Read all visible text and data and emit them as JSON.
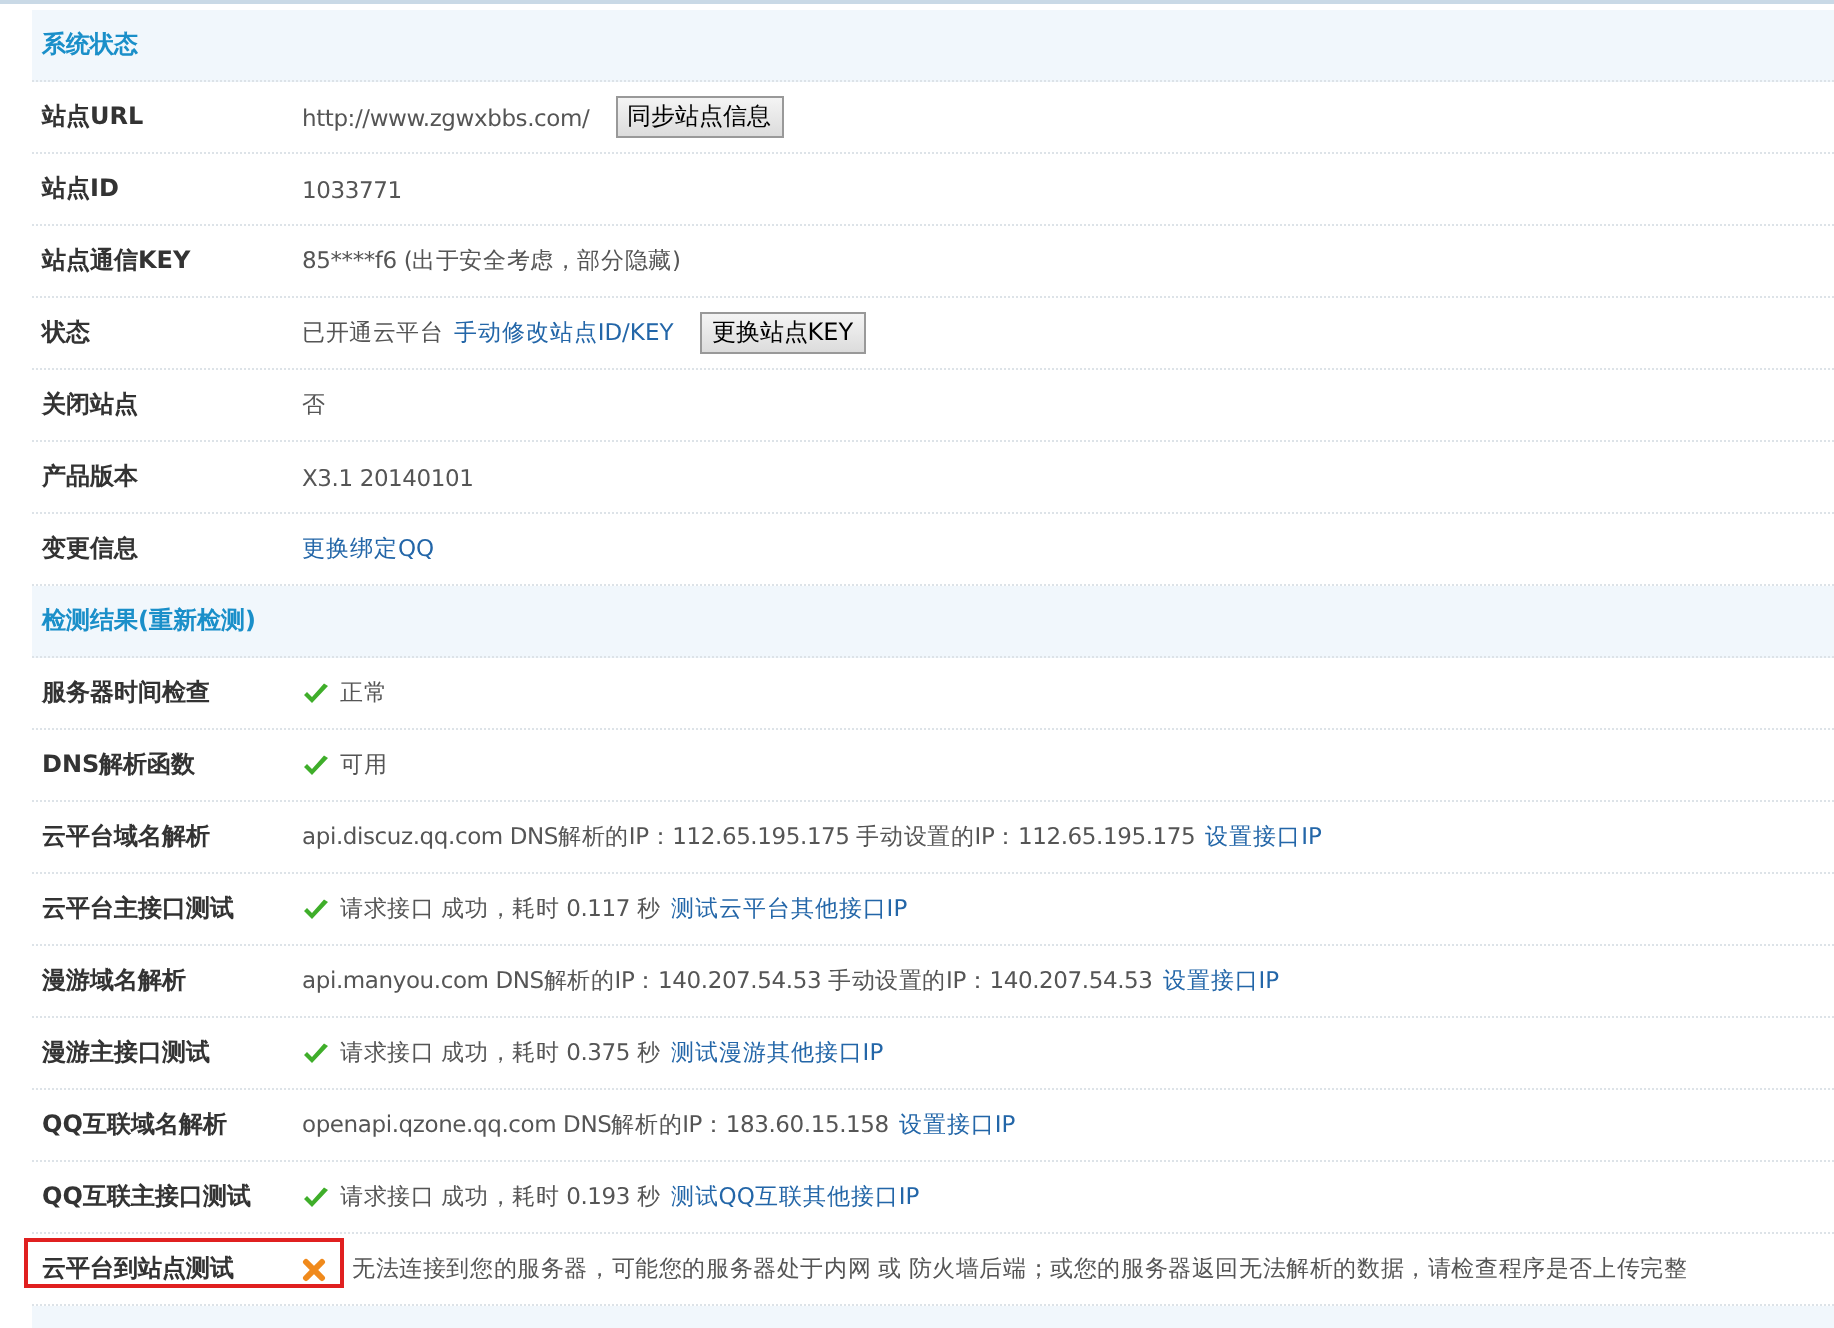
{
  "sections": [
    {
      "title": "系统状态",
      "rows": [
        {
          "label": "站点URL",
          "parts": [
            {
              "kind": "text",
              "text": "http://www.zgwxbbs.com/"
            },
            {
              "kind": "button",
              "text": "同步站点信息"
            }
          ]
        },
        {
          "label": "站点ID",
          "parts": [
            {
              "kind": "text",
              "text": "1033771"
            }
          ]
        },
        {
          "label": "站点通信KEY",
          "parts": [
            {
              "kind": "text",
              "text": "85****f6 (出于安全考虑，部分隐藏)"
            }
          ]
        },
        {
          "label": "状态",
          "parts": [
            {
              "kind": "text",
              "text": "已开通云平台"
            },
            {
              "kind": "link",
              "text": "手动修改站点ID/KEY"
            },
            {
              "kind": "button",
              "text": "更换站点KEY"
            }
          ]
        },
        {
          "label": "关闭站点",
          "parts": [
            {
              "kind": "text",
              "text": "否"
            }
          ]
        },
        {
          "label": "产品版本",
          "parts": [
            {
              "kind": "text",
              "text": "X3.1 20140101"
            }
          ]
        },
        {
          "label": "变更信息",
          "parts": [
            {
              "kind": "link",
              "text": "更换绑定QQ"
            }
          ]
        }
      ]
    },
    {
      "title": "检测结果(重新检测)",
      "rows": [
        {
          "label": "服务器时间检查",
          "passed": true,
          "parts": [
            {
              "kind": "text",
              "text": "正常"
            }
          ]
        },
        {
          "label": "DNS解析函数",
          "passed": true,
          "parts": [
            {
              "kind": "text",
              "text": "可用"
            }
          ]
        },
        {
          "label": "云平台域名解析",
          "parts": [
            {
              "kind": "text",
              "text": "api.discuz.qq.com DNS解析的IP：112.65.195.175 手动设置的IP：112.65.195.175"
            },
            {
              "kind": "link",
              "text": "设置接口IP"
            }
          ]
        },
        {
          "label": "云平台主接口测试",
          "passed": true,
          "parts": [
            {
              "kind": "text",
              "text": "请求接口 成功，耗时 0.117 秒"
            },
            {
              "kind": "link",
              "text": "测试云平台其他接口IP"
            }
          ]
        },
        {
          "label": "漫游域名解析",
          "parts": [
            {
              "kind": "text",
              "text": "api.manyou.com DNS解析的IP：140.207.54.53 手动设置的IP：140.207.54.53"
            },
            {
              "kind": "link",
              "text": "设置接口IP"
            }
          ]
        },
        {
          "label": "漫游主接口测试",
          "passed": true,
          "parts": [
            {
              "kind": "text",
              "text": "请求接口 成功，耗时 0.375 秒"
            },
            {
              "kind": "link",
              "text": "测试漫游其他接口IP"
            }
          ]
        },
        {
          "label": "QQ互联域名解析",
          "parts": [
            {
              "kind": "text",
              "text": "openapi.qzone.qq.com DNS解析的IP：183.60.15.158"
            },
            {
              "kind": "link",
              "text": "设置接口IP"
            }
          ]
        },
        {
          "label": "QQ互联主接口测试",
          "passed": true,
          "parts": [
            {
              "kind": "text",
              "text": "请求接口 成功，耗时 0.193 秒"
            },
            {
              "kind": "link",
              "text": "测试QQ互联其他接口IP"
            }
          ]
        },
        {
          "label": "云平台到站点测试",
          "passed": false,
          "highlighted": true,
          "parts": [
            {
              "kind": "text",
              "text": "无法连接到您的服务器，可能您的服务器处于内网 或 防火墙后端；或您的服务器返回无法解析的数据，请检查程序是否上传完整"
            }
          ]
        }
      ]
    }
  ]
}
